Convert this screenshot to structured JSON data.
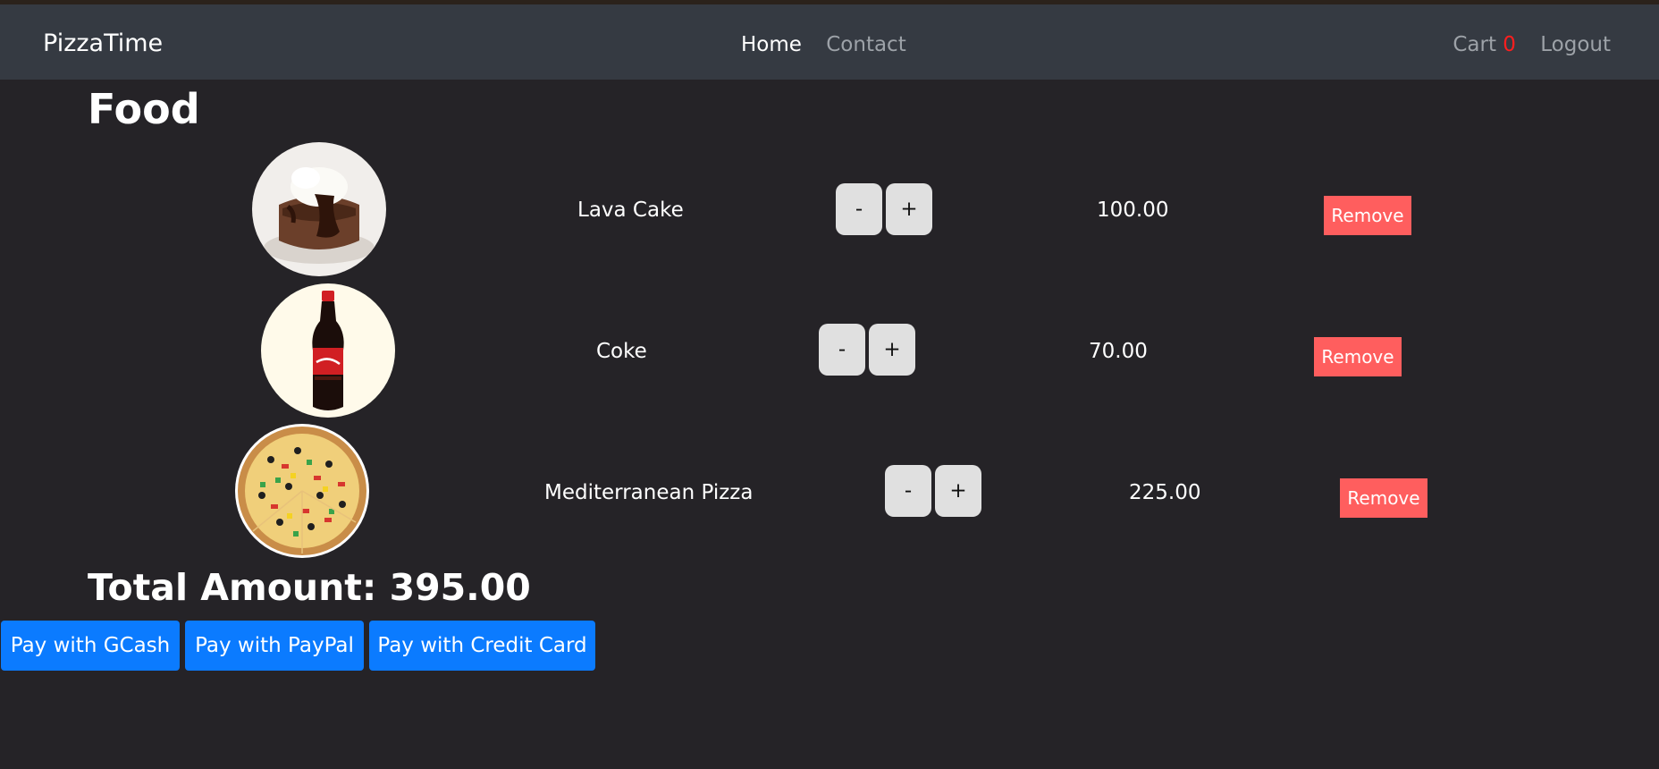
{
  "nav": {
    "brand": "PizzaTime",
    "home": "Home",
    "contact": "Contact",
    "cart_label": "Cart",
    "cart_count": "0",
    "logout": "Logout"
  },
  "page": {
    "title": "Food",
    "total_label": "Total Amount:",
    "total_value": "395.00"
  },
  "items": [
    {
      "name": "Lava Cake",
      "minus": "-",
      "plus": "+",
      "price": "100.00",
      "remove": "Remove",
      "icon": "lava-cake-image"
    },
    {
      "name": "Coke",
      "minus": "-",
      "plus": "+",
      "price": "70.00",
      "remove": "Remove",
      "icon": "coke-bottle-image"
    },
    {
      "name": "Mediterranean Pizza",
      "minus": "-",
      "plus": "+",
      "price": "225.00",
      "remove": "Remove",
      "icon": "pizza-image"
    }
  ],
  "payments": {
    "gcash": "Pay with GCash",
    "paypal": "Pay with PayPal",
    "card": "Pay with Credit Card"
  },
  "colors": {
    "background": "#252327",
    "navbar": "#353a42",
    "remove": "#ff5e5e",
    "pay": "#0b7bff",
    "cart_count": "#ff1e1e"
  }
}
